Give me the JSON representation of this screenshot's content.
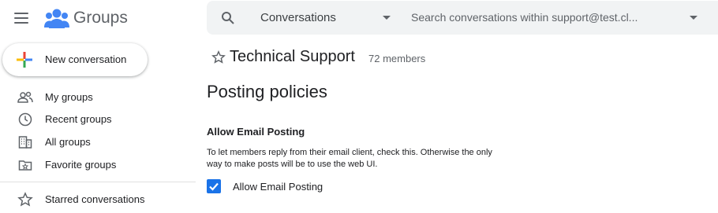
{
  "app": {
    "name": "Groups",
    "menu_icon": "hamburger-menu-icon",
    "logo_icon": "groups-logo-icon"
  },
  "new_conversation": {
    "label": "New conversation",
    "icon": "multicolor-plus-icon",
    "colors": {
      "red": "#ea4335",
      "blue": "#4285f4",
      "yellow": "#fbbc04",
      "green": "#34a853"
    }
  },
  "sidebar": {
    "items": [
      {
        "label": "My groups",
        "icon": "people-outline-icon"
      },
      {
        "label": "Recent groups",
        "icon": "clock-icon"
      },
      {
        "label": "All groups",
        "icon": "building-icon"
      },
      {
        "label": "Favorite groups",
        "icon": "folder-star-icon"
      }
    ],
    "starred": {
      "label": "Starred conversations",
      "icon": "star-outline-icon"
    }
  },
  "search": {
    "icon": "search-icon",
    "scope_value": "Conversations",
    "placeholder": "Search conversations within support@test.cl...",
    "options_icon": "dropdown-arrow-icon"
  },
  "group": {
    "name": "Technical Support",
    "member_count": "72 members",
    "star_icon": "star-outline-icon"
  },
  "page": {
    "heading": "Posting policies",
    "section_title": "Allow Email Posting",
    "description": "To let members reply from their email client, check this. Otherwise the only way to make posts will be to use the web UI.",
    "checkbox_label": "Allow Email Posting",
    "checkbox_checked": true
  },
  "colors": {
    "accent": "#1a73e8",
    "logo_blue": "#4285f4",
    "search_bg": "#f1f3f4",
    "icon_gray": "#5f6368",
    "text": "#202124"
  }
}
